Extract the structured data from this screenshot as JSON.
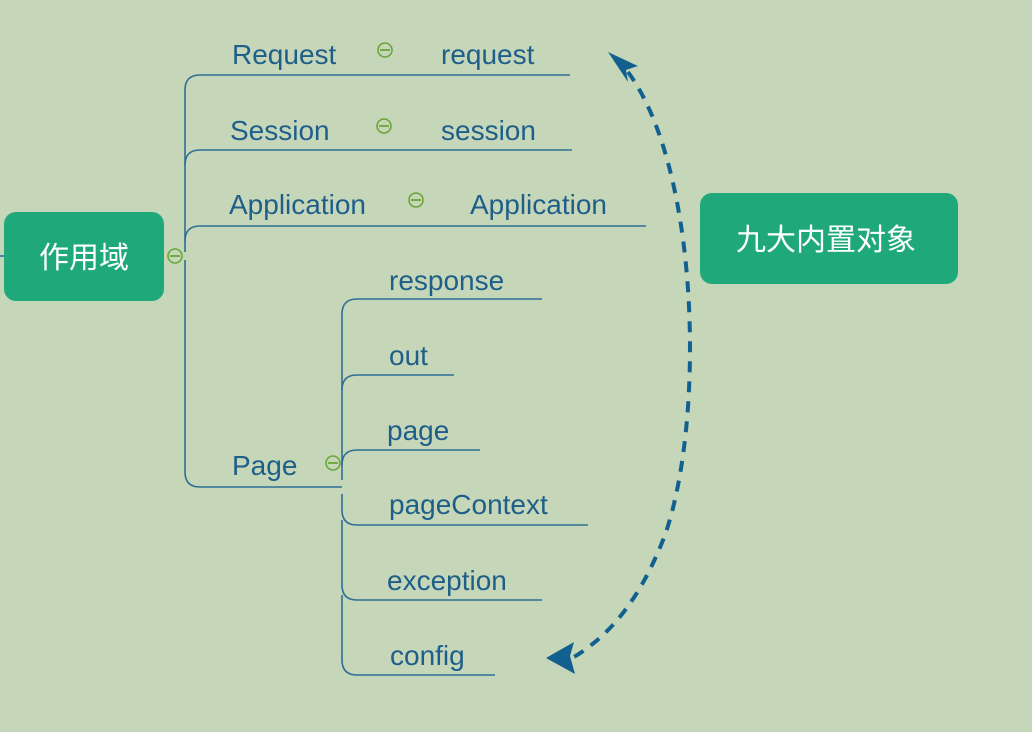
{
  "diagram": {
    "root": {
      "label": "作用域",
      "color": "#1fa97b"
    },
    "target": {
      "label": "九大内置对象",
      "color": "#1fa97b"
    },
    "branches": [
      {
        "scope": "Request",
        "object": "request"
      },
      {
        "scope": "Session",
        "object": "session"
      },
      {
        "scope": "Application",
        "object": "Application"
      }
    ],
    "page": {
      "scope": "Page",
      "objects": [
        "response",
        "out",
        "page",
        "pageContext",
        "exception",
        "config"
      ]
    },
    "colors": {
      "background": "#c6d6b8",
      "line": "#2f6f94",
      "label": "#1e5f8a",
      "collapse": "#6aa63a",
      "arrow": "#11608f"
    },
    "icons": {
      "collapse": "collapse-minus-icon",
      "arrow": "double-headed-arrow"
    }
  }
}
